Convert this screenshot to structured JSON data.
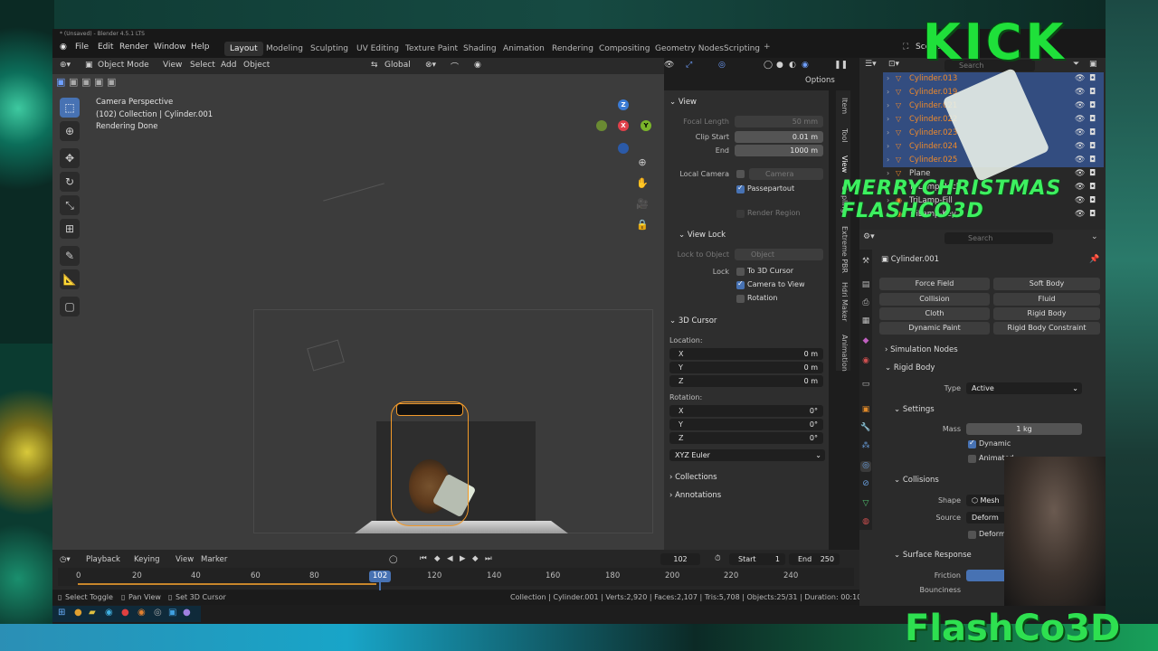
{
  "window_title": "* (Unsaved) - Blender 4.5.1 LTS",
  "menu": [
    "File",
    "Edit",
    "Render",
    "Window",
    "Help"
  ],
  "workspaces": [
    "Layout",
    "Modeling",
    "Sculpting",
    "UV Editing",
    "Texture Paint",
    "Shading",
    "Animation",
    "Rendering",
    "Compositing",
    "Geometry Nodes",
    "Scripting"
  ],
  "header": {
    "mode": "Object Mode",
    "view": "View",
    "select": "Select",
    "add": "Add",
    "object": "Object",
    "orientation": "Global",
    "options": "Options",
    "scene": "Scene"
  },
  "viewport_info": {
    "line1": "Camera Perspective",
    "line2": "(102) Collection | Cylinder.001",
    "line3": "Rendering Done"
  },
  "npanel": {
    "view_title": "View",
    "focal_length_label": "Focal Length",
    "focal_length": "50 mm",
    "clip_start_label": "Clip Start",
    "clip_start": "0.01 m",
    "end_label": "End",
    "clip_end": "1000 m",
    "local_camera_label": "Local Camera",
    "local_camera": "Camera",
    "passepartout": "Passepartout",
    "render_region": "Render Region",
    "view_lock_title": "View Lock",
    "lock_to_object_label": "Lock to Object",
    "lock_to_object": "Object",
    "lock_label": "Lock",
    "to_3d_cursor": "To 3D Cursor",
    "camera_to_view": "Camera to View",
    "rotation_lock": "Rotation",
    "cursor_title": "3D Cursor",
    "location_label": "Location:",
    "loc_x": "0 m",
    "loc_y": "0 m",
    "loc_z": "0 m",
    "rotation_label": "Rotation:",
    "rot_x": "0°",
    "rot_y": "0°",
    "rot_z": "0°",
    "rotation_mode": "XYZ Euler",
    "collections": "Collections",
    "annotations": "Annotations",
    "x": "X",
    "y": "Y",
    "z": "Z"
  },
  "ntabs": [
    "Item",
    "Tool",
    "View",
    "Sapling",
    "Extreme PBR",
    "Hdri Maker",
    "Animation"
  ],
  "timeline": {
    "playback": "Playback",
    "keying": "Keying",
    "view": "View",
    "marker": "Marker",
    "current_frame": "102",
    "start_label": "Start",
    "start": "1",
    "end_label": "End",
    "end": "250",
    "ticks": [
      "0",
      "20",
      "40",
      "60",
      "80",
      "120",
      "140",
      "160",
      "180",
      "200",
      "220",
      "240"
    ]
  },
  "statusbar": {
    "select_toggle": "Select Toggle",
    "pan_view": "Pan View",
    "set_cursor": "Set 3D Cursor",
    "stats": "Collection | Cylinder.001 | Verts:2,920 | Faces:2,107 | Tris:5,708 | Objects:25/31 | Duration: 00:10+10 (Frame 102/250) | Memory: 2.0"
  },
  "outliner": {
    "search_placeholder": "Search",
    "rows": [
      {
        "name": "Cylinder.013",
        "selected": true
      },
      {
        "name": "Cylinder.019",
        "selected": true
      },
      {
        "name": "Cylinder.021",
        "selected": true
      },
      {
        "name": "Cylinder.022",
        "selected": true
      },
      {
        "name": "Cylinder.023",
        "selected": true
      },
      {
        "name": "Cylinder.024",
        "selected": true
      },
      {
        "name": "Cylinder.025",
        "selected": true
      },
      {
        "name": "Plane",
        "selected": false
      },
      {
        "name": "TriLamp-Back",
        "selected": false
      },
      {
        "name": "TriLamp-Fill",
        "selected": false
      },
      {
        "name": "TriLamp-Key",
        "selected": false
      }
    ]
  },
  "properties": {
    "search_placeholder": "Search",
    "object_name": "Cylinder.001",
    "physics_buttons": [
      "Force Field",
      "Soft Body",
      "Collision",
      "Fluid",
      "Cloth",
      "Rigid Body",
      "Dynamic Paint",
      "Rigid Body Constraint"
    ],
    "simulation_nodes": "Simulation Nodes",
    "rigid_body": "Rigid Body",
    "type_label": "Type",
    "type_value": "Active",
    "settings": "Settings",
    "mass_label": "Mass",
    "mass_value": "1 kg",
    "dynamic": "Dynamic",
    "animated": "Animated",
    "collisions": "Collisions",
    "shape_label": "Shape",
    "shape_value": "Mesh",
    "source_label": "Source",
    "source_value": "Deform",
    "deforming": "Deforming",
    "surface_response": "Surface Response",
    "friction_label": "Friction",
    "bounciness_label": "Bounciness"
  },
  "overlays": {
    "kick": "KICK",
    "banner": "MERRYCHRISTMAS FLASHCO3D",
    "logo": "FlashCo3D"
  },
  "colors": {
    "accent": "#4772b3",
    "selected_orange": "#f08a2a",
    "overlay_green": "#2ee050"
  }
}
